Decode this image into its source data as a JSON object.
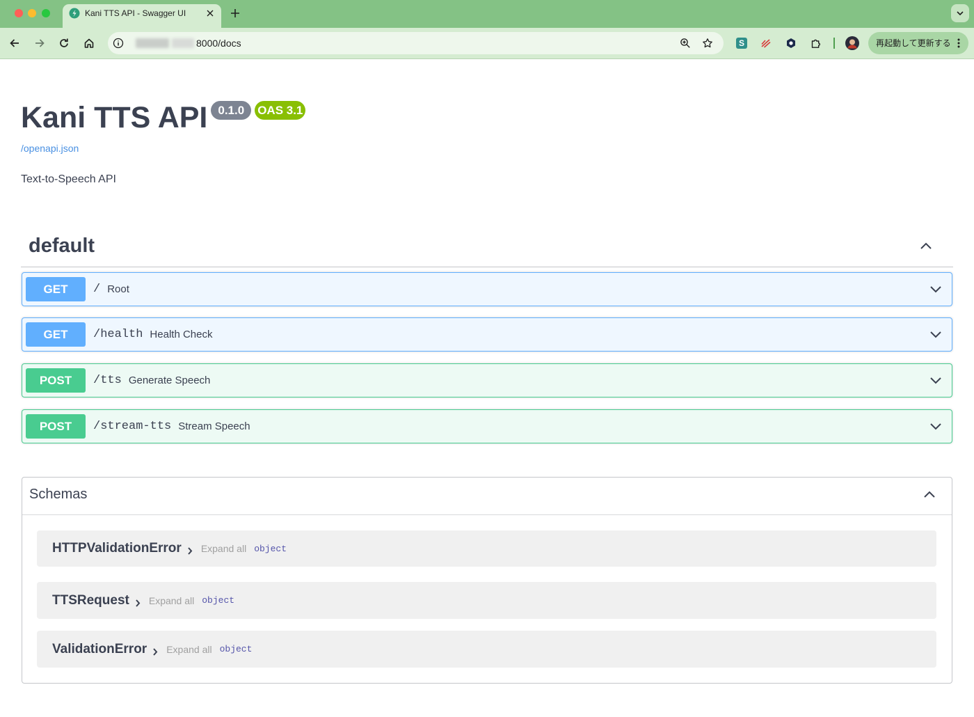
{
  "browser": {
    "tab_title": "Kani TTS API - Swagger UI",
    "url_visible": "8000/docs",
    "extension_s_glyph": "S",
    "update_button_label": "再起動して更新する"
  },
  "info": {
    "title": "Kani TTS API",
    "version": "0.1.0",
    "oas": "OAS 3.1",
    "spec_link": "/openapi.json",
    "description": "Text-to-Speech API"
  },
  "tag": {
    "name": "default"
  },
  "operations": [
    {
      "method": "GET",
      "path": "/",
      "summary": "Root"
    },
    {
      "method": "GET",
      "path": "/health",
      "summary": "Health Check"
    },
    {
      "method": "POST",
      "path": "/tts",
      "summary": "Generate Speech"
    },
    {
      "method": "POST",
      "path": "/stream-tts",
      "summary": "Stream Speech"
    }
  ],
  "schemas": {
    "title": "Schemas",
    "items": [
      {
        "name": "HTTPValidationError",
        "expand_label": "Expand all",
        "type": "object"
      },
      {
        "name": "TTSRequest",
        "expand_label": "Expand all",
        "type": "object"
      },
      {
        "name": "ValidationError",
        "expand_label": "Expand all",
        "type": "object"
      }
    ]
  },
  "icons": {
    "toolbar": [
      "back-arrow-icon",
      "forward-arrow-icon",
      "reload-icon",
      "home-icon"
    ],
    "url_bar": [
      "site-info-icon",
      "zoom-icon",
      "bookmark-star-icon"
    ],
    "extensions": [
      "s-extension-icon",
      "strike-extension-icon",
      "hexagon-extension-icon",
      "puzzle-icon",
      "profile-avatar"
    ],
    "sections": [
      "chevron-up-icon",
      "chevron-down-icon",
      "chevron-right-icon"
    ]
  },
  "colors": {
    "get": "#61affe",
    "post": "#49cc90",
    "version_badge": "#7d8492",
    "oas_badge": "#89bf04",
    "link": "#4990e2",
    "text": "#3b4151",
    "schema_type": "#5555aa"
  }
}
